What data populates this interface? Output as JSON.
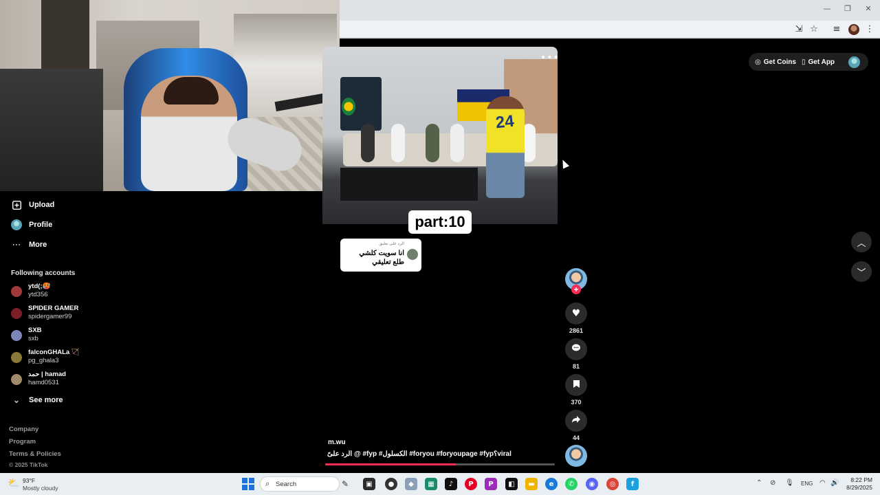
{
  "browser": {
    "window_minimize": "—",
    "window_maximize": "❐",
    "window_close": "✕"
  },
  "sidebar": {
    "upload_label": "Upload",
    "profile_label": "Profile",
    "more_label": "More",
    "following_title": "Following accounts",
    "accounts": [
      {
        "name": "ytd(;🥵",
        "username": "ytd356",
        "color": "#a03a3a"
      },
      {
        "name": "SPIDER GAMER",
        "username": "spidergamer99",
        "color": "#7a1e2a"
      },
      {
        "name": "SXB",
        "username": "sxb",
        "color": "#7d86b8"
      },
      {
        "name": "falconGHALa 🏹",
        "username": "pg_ghala3",
        "color": "#8a7a3a"
      },
      {
        "name": "حمد | hamad",
        "username": "hamd0531",
        "color": "#a08a6a"
      }
    ],
    "see_more_label": "See more",
    "footer": {
      "company": "Company",
      "program": "Program",
      "terms": "Terms & Policies",
      "copyright": "© 2025 TikTok"
    }
  },
  "video": {
    "jersey_number": "24",
    "part_label": "part:10",
    "reply_header": "الرد على تعليق",
    "reply_text": "انا سويت كلشي طلع تعليقي",
    "creator": "m.wu",
    "caption": "الرد علىً @ #fyp #الكسلول #foryou #foryoupage #fyp؟viral",
    "progress": 0.57
  },
  "actions": {
    "likes": "2861",
    "comments": "81",
    "saves": "370",
    "shares": "44"
  },
  "topbar": {
    "get_coins": "Get Coins",
    "get_app": "Get App"
  },
  "taskbar": {
    "weather_temp": "93°F",
    "weather_desc": "Mostly cloudy",
    "search_label": "Search",
    "language": "ENG",
    "time": "8:22 PM",
    "date": "8/29/2025"
  },
  "colors": {
    "accent": "#fe2c55"
  }
}
